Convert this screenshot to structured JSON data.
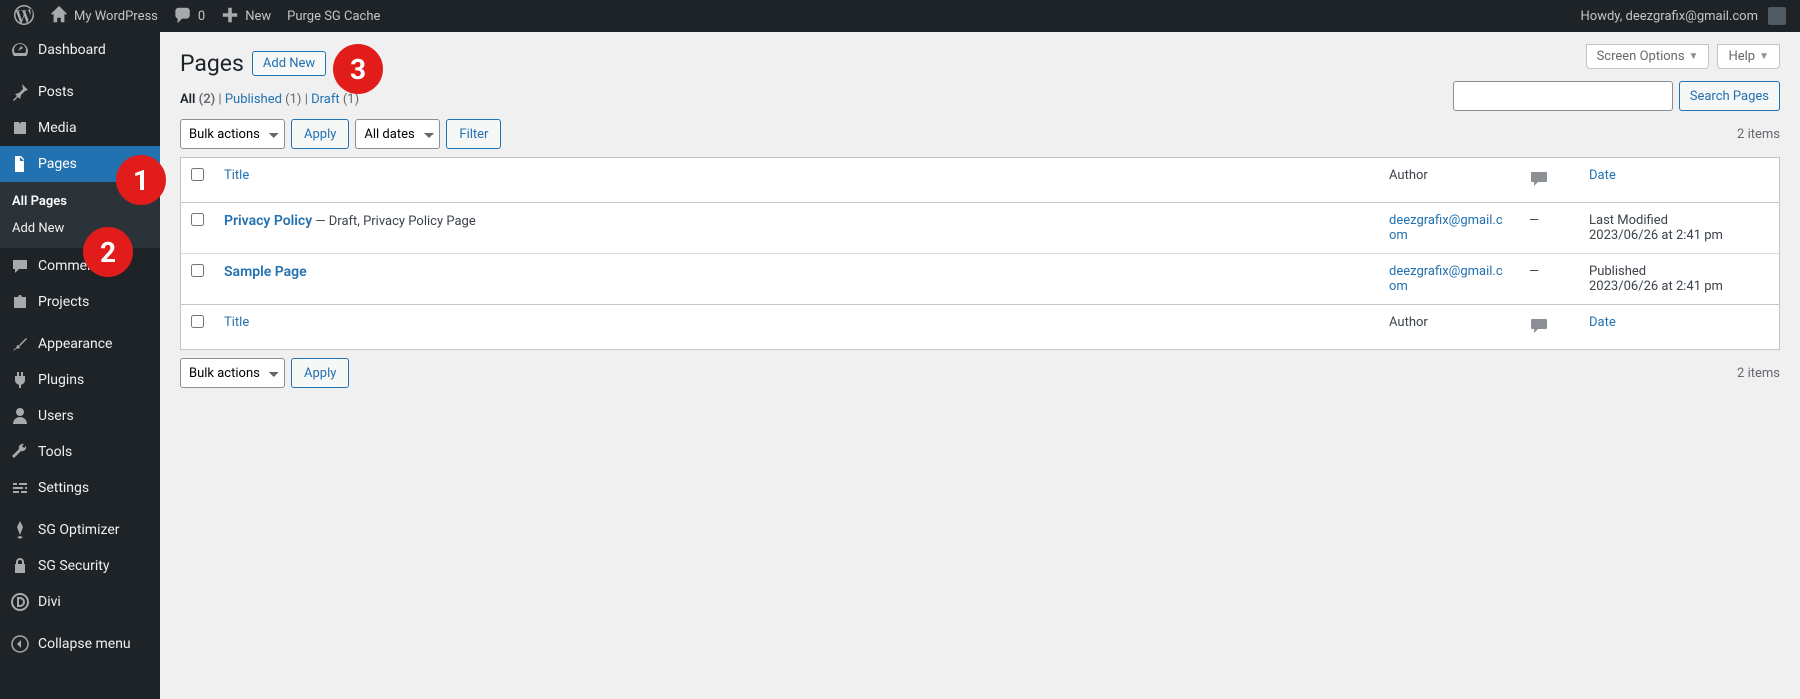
{
  "admin_bar": {
    "site": "My WordPress",
    "comments": "0",
    "new": "New",
    "purge": "Purge SG Cache",
    "howdy": "Howdy, deezgrafix@gmail.com"
  },
  "sidebar": {
    "dashboard": "Dashboard",
    "posts": "Posts",
    "media": "Media",
    "pages": "Pages",
    "pages_sub_all": "All Pages",
    "pages_sub_add": "Add New",
    "comments": "Comments",
    "projects": "Projects",
    "appearance": "Appearance",
    "plugins": "Plugins",
    "users": "Users",
    "tools": "Tools",
    "settings": "Settings",
    "sg_optimizer": "SG Optimizer",
    "sg_security": "SG Security",
    "divi": "Divi",
    "collapse": "Collapse menu"
  },
  "annotations": {
    "a1": "1",
    "a2": "2",
    "a3": "3"
  },
  "header": {
    "screen_options": "Screen Options",
    "help": "Help",
    "title": "Pages",
    "add_new": "Add New"
  },
  "filters": {
    "all": "All",
    "all_count": "(2)",
    "published": "Published",
    "published_count": "(1)",
    "draft": "Draft",
    "draft_count": "(1)",
    "sep": " | "
  },
  "search": {
    "button": "Search Pages",
    "value": ""
  },
  "tablenav": {
    "bulk": "Bulk actions",
    "apply": "Apply",
    "dates": "All dates",
    "filter": "Filter",
    "items": "2 items"
  },
  "table": {
    "col_title": "Title",
    "col_author": "Author",
    "col_date": "Date",
    "rows": [
      {
        "title": "Privacy Policy",
        "state": " — Draft, Privacy Policy Page",
        "author": "deezgrafix@gmail.com",
        "comments": "—",
        "date_label": "Last Modified",
        "date_value": "2023/06/26 at 2:41 pm"
      },
      {
        "title": "Sample Page",
        "state": "",
        "author": "deezgrafix@gmail.com",
        "comments": "—",
        "date_label": "Published",
        "date_value": "2023/06/26 at 2:41 pm"
      }
    ]
  }
}
